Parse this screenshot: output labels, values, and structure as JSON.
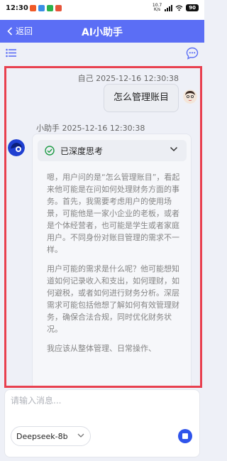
{
  "status": {
    "time": "12:30",
    "network_top": "10.7",
    "network_bottom": "K/s",
    "battery": "90"
  },
  "nav": {
    "back_label": "返回",
    "title": "AI小助手"
  },
  "user_message": {
    "meta": "自己  2025-12-16 12:30:38",
    "text": "怎么管理账目"
  },
  "bot_message": {
    "meta": "小助手  2025-12-16 12:30:38",
    "thinking_label": "已深度思考",
    "paragraphs": [
      "嗯，用户问的是“怎么管理账目”，看起来他可能是在问如何处理财务方面的事务。首先，我需要考虑用户的使用场景，可能他是一家小企业的老板，或者是个体经营者，也可能是学生或者家庭用户。不同身份对账目管理的需求不一样。",
      "用户可能的需求是什么呢？他可能想知道如何记录收入和支出，如何理财，如何避税，或者如何进行财务分析。深层需求可能包括他想了解如何有效管理财务，确保合法合规，同时优化财务状况。",
      "我应该从整体管理、日常操作、"
    ]
  },
  "input": {
    "placeholder": "请输入消息..."
  },
  "model": {
    "selected": "Deepseek-8b"
  },
  "colors": {
    "primary": "#5b6ef5",
    "highlight_border": "#e8404f",
    "stop_button": "#2f54eb",
    "check_green": "#1e9c46"
  }
}
